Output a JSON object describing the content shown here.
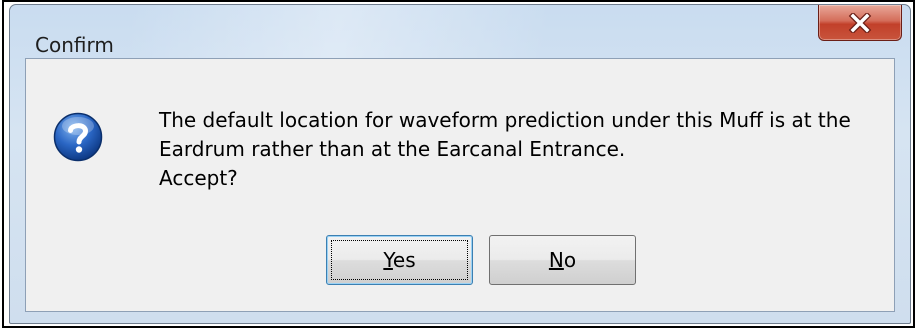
{
  "window": {
    "title": "Confirm",
    "close_label": "Close"
  },
  "message": {
    "lines": [
      "The default location for waveform prediction under this Muff is at the",
      "Eardrum rather than at the Earcanal Entrance.",
      "Accept?"
    ],
    "icon": "question-icon"
  },
  "buttons": {
    "yes": {
      "mnemonic": "Y",
      "rest": "es"
    },
    "no": {
      "mnemonic": "N",
      "rest": "o"
    }
  },
  "colors": {
    "close_button": "#c8543c",
    "question_icon": "#1f5fb5",
    "focus_border": "#3c7fb1"
  }
}
